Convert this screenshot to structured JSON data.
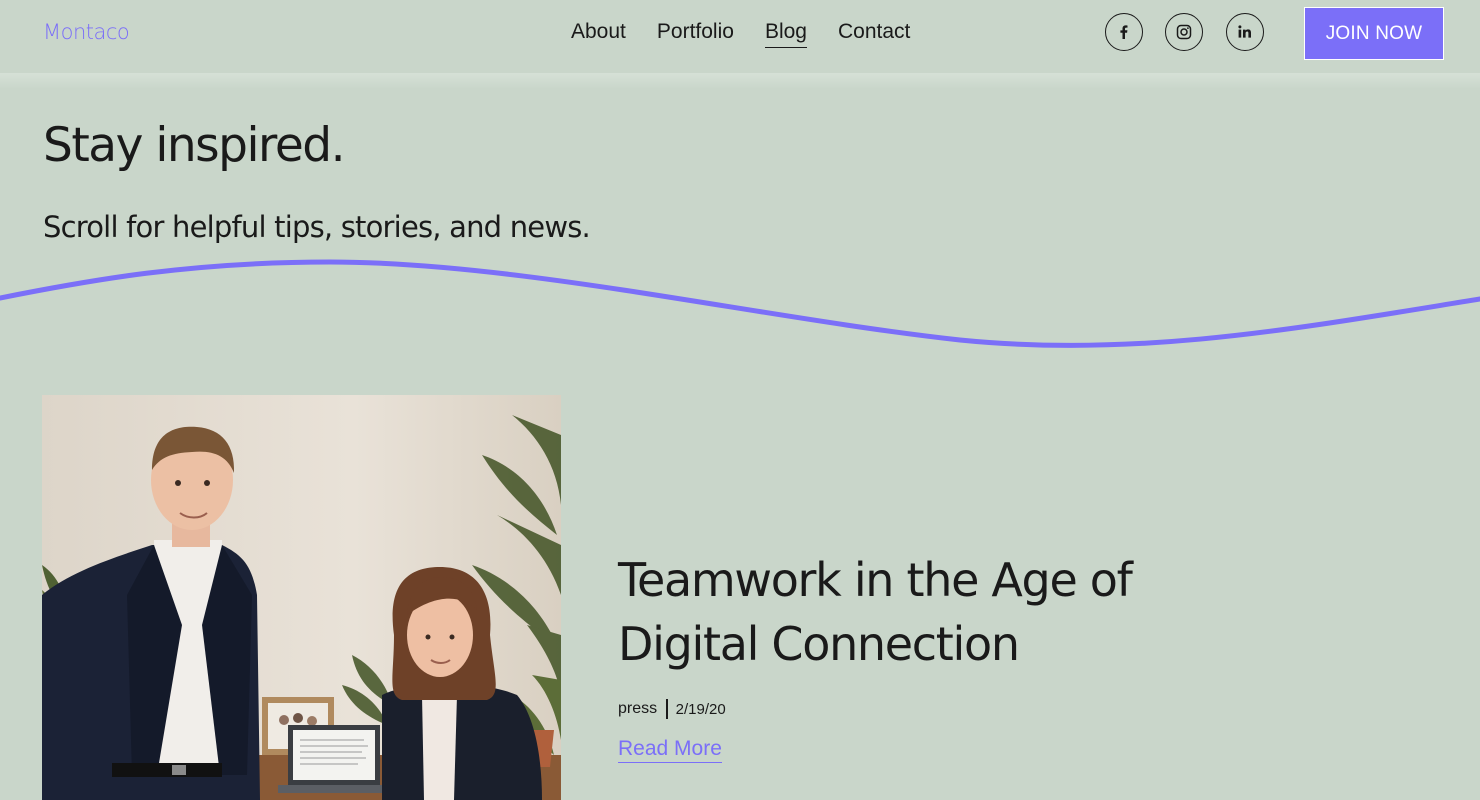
{
  "brand": {
    "logo": "Montaco"
  },
  "nav": {
    "items": [
      {
        "label": "About"
      },
      {
        "label": "Portfolio"
      },
      {
        "label": "Blog",
        "active": true
      },
      {
        "label": "Contact"
      }
    ]
  },
  "social": [
    {
      "icon": "facebook-icon",
      "glyph": "f"
    },
    {
      "icon": "instagram-icon"
    },
    {
      "icon": "linkedin-icon",
      "glyph": "in"
    }
  ],
  "cta": {
    "label": "JOIN NOW"
  },
  "hero": {
    "title": "Stay inspired.",
    "subtitle": "Scroll for helpful tips, stories, and news."
  },
  "post": {
    "title": "Teamwork in the Age of Digital Connection",
    "category": "press",
    "date": "2/19/20",
    "read_more": "Read More"
  },
  "colors": {
    "background": "#c9d6ca",
    "accent": "#7b6ff8",
    "text": "#1a1a1a"
  }
}
